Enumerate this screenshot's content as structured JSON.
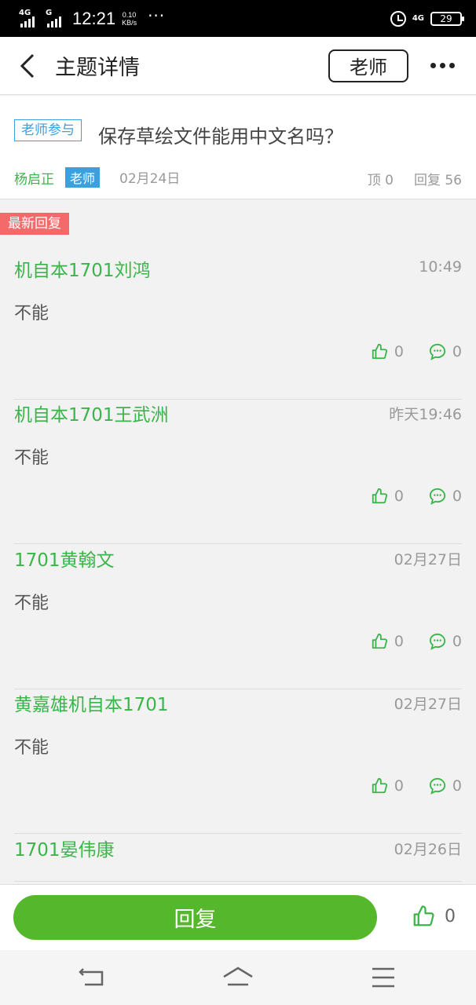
{
  "status_bar": {
    "sim1": "4G",
    "sim2": "G",
    "time": "12:21",
    "speed_value": "0.10",
    "speed_unit": "KB/s",
    "more": "···",
    "network": "4G",
    "battery": "29"
  },
  "header": {
    "title": "主题详情",
    "role_button": "老师"
  },
  "topic": {
    "tag": "老师参与",
    "title": "保存草绘文件能用中文名吗？",
    "author": "杨启正",
    "author_role": "老师",
    "date": "02月24日",
    "top_count": "顶 0",
    "reply_count": "回复 56"
  },
  "replies_label": "最新回复",
  "replies": [
    {
      "name": "机自本1701刘鸿",
      "time": "10:49",
      "text": "不能",
      "likes": "0",
      "comments": "0"
    },
    {
      "name": "机自本1701王武洲",
      "time": "昨天19:46",
      "text": "不能",
      "likes": "0",
      "comments": "0"
    },
    {
      "name": "1701黄翰文",
      "time": "02月27日",
      "text": "不能",
      "likes": "0",
      "comments": "0"
    },
    {
      "name": "黄嘉雄机自本1701",
      "time": "02月27日",
      "text": "不能",
      "likes": "0",
      "comments": "0"
    },
    {
      "name": "1701晏伟康",
      "time": "02月26日"
    }
  ],
  "reply_bar": {
    "button": "回复",
    "likes": "0"
  },
  "colors": {
    "green": "#3ab54a",
    "button_green": "#55b82c",
    "blue": "#3aa0e0",
    "red_badge": "#f46a6a"
  }
}
